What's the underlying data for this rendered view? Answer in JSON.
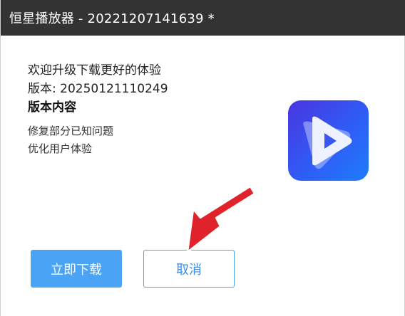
{
  "window": {
    "title": "恒星播放器 - 20221207141639 *"
  },
  "update": {
    "welcome": "欢迎升级下载更好的体验",
    "version_line": "版本: 20250121110249",
    "contents_heading": "版本内容",
    "notes": [
      "修复部分已知问题",
      "优化用户体验"
    ]
  },
  "buttons": {
    "download_label": "立即下载",
    "cancel_label": "取消"
  },
  "icons": {
    "app_logo": "play-logo-icon",
    "annotation": "red-arrow-icon"
  },
  "colors": {
    "titlebar_bg": "#333333",
    "primary": "#4aa3f4",
    "arrow": "#e0222a",
    "logo_gradient_start": "#4a35e0",
    "logo_gradient_end": "#1f7dfb"
  }
}
